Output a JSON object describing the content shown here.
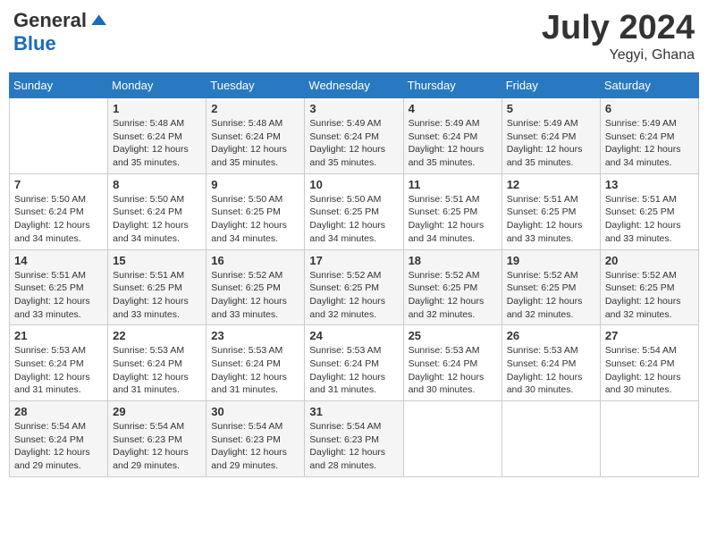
{
  "header": {
    "logo_general": "General",
    "logo_blue": "Blue",
    "month_year": "July 2024",
    "location": "Yegyi, Ghana"
  },
  "weekdays": [
    "Sunday",
    "Monday",
    "Tuesday",
    "Wednesday",
    "Thursday",
    "Friday",
    "Saturday"
  ],
  "weeks": [
    [
      {
        "day": "",
        "sunrise": "",
        "sunset": "",
        "daylight": ""
      },
      {
        "day": "1",
        "sunrise": "Sunrise: 5:48 AM",
        "sunset": "Sunset: 6:24 PM",
        "daylight": "Daylight: 12 hours and 35 minutes."
      },
      {
        "day": "2",
        "sunrise": "Sunrise: 5:48 AM",
        "sunset": "Sunset: 6:24 PM",
        "daylight": "Daylight: 12 hours and 35 minutes."
      },
      {
        "day": "3",
        "sunrise": "Sunrise: 5:49 AM",
        "sunset": "Sunset: 6:24 PM",
        "daylight": "Daylight: 12 hours and 35 minutes."
      },
      {
        "day": "4",
        "sunrise": "Sunrise: 5:49 AM",
        "sunset": "Sunset: 6:24 PM",
        "daylight": "Daylight: 12 hours and 35 minutes."
      },
      {
        "day": "5",
        "sunrise": "Sunrise: 5:49 AM",
        "sunset": "Sunset: 6:24 PM",
        "daylight": "Daylight: 12 hours and 35 minutes."
      },
      {
        "day": "6",
        "sunrise": "Sunrise: 5:49 AM",
        "sunset": "Sunset: 6:24 PM",
        "daylight": "Daylight: 12 hours and 34 minutes."
      }
    ],
    [
      {
        "day": "7",
        "sunrise": "Sunrise: 5:50 AM",
        "sunset": "Sunset: 6:24 PM",
        "daylight": "Daylight: 12 hours and 34 minutes."
      },
      {
        "day": "8",
        "sunrise": "Sunrise: 5:50 AM",
        "sunset": "Sunset: 6:24 PM",
        "daylight": "Daylight: 12 hours and 34 minutes."
      },
      {
        "day": "9",
        "sunrise": "Sunrise: 5:50 AM",
        "sunset": "Sunset: 6:25 PM",
        "daylight": "Daylight: 12 hours and 34 minutes."
      },
      {
        "day": "10",
        "sunrise": "Sunrise: 5:50 AM",
        "sunset": "Sunset: 6:25 PM",
        "daylight": "Daylight: 12 hours and 34 minutes."
      },
      {
        "day": "11",
        "sunrise": "Sunrise: 5:51 AM",
        "sunset": "Sunset: 6:25 PM",
        "daylight": "Daylight: 12 hours and 34 minutes."
      },
      {
        "day": "12",
        "sunrise": "Sunrise: 5:51 AM",
        "sunset": "Sunset: 6:25 PM",
        "daylight": "Daylight: 12 hours and 33 minutes."
      },
      {
        "day": "13",
        "sunrise": "Sunrise: 5:51 AM",
        "sunset": "Sunset: 6:25 PM",
        "daylight": "Daylight: 12 hours and 33 minutes."
      }
    ],
    [
      {
        "day": "14",
        "sunrise": "Sunrise: 5:51 AM",
        "sunset": "Sunset: 6:25 PM",
        "daylight": "Daylight: 12 hours and 33 minutes."
      },
      {
        "day": "15",
        "sunrise": "Sunrise: 5:51 AM",
        "sunset": "Sunset: 6:25 PM",
        "daylight": "Daylight: 12 hours and 33 minutes."
      },
      {
        "day": "16",
        "sunrise": "Sunrise: 5:52 AM",
        "sunset": "Sunset: 6:25 PM",
        "daylight": "Daylight: 12 hours and 33 minutes."
      },
      {
        "day": "17",
        "sunrise": "Sunrise: 5:52 AM",
        "sunset": "Sunset: 6:25 PM",
        "daylight": "Daylight: 12 hours and 32 minutes."
      },
      {
        "day": "18",
        "sunrise": "Sunrise: 5:52 AM",
        "sunset": "Sunset: 6:25 PM",
        "daylight": "Daylight: 12 hours and 32 minutes."
      },
      {
        "day": "19",
        "sunrise": "Sunrise: 5:52 AM",
        "sunset": "Sunset: 6:25 PM",
        "daylight": "Daylight: 12 hours and 32 minutes."
      },
      {
        "day": "20",
        "sunrise": "Sunrise: 5:52 AM",
        "sunset": "Sunset: 6:25 PM",
        "daylight": "Daylight: 12 hours and 32 minutes."
      }
    ],
    [
      {
        "day": "21",
        "sunrise": "Sunrise: 5:53 AM",
        "sunset": "Sunset: 6:24 PM",
        "daylight": "Daylight: 12 hours and 31 minutes."
      },
      {
        "day": "22",
        "sunrise": "Sunrise: 5:53 AM",
        "sunset": "Sunset: 6:24 PM",
        "daylight": "Daylight: 12 hours and 31 minutes."
      },
      {
        "day": "23",
        "sunrise": "Sunrise: 5:53 AM",
        "sunset": "Sunset: 6:24 PM",
        "daylight": "Daylight: 12 hours and 31 minutes."
      },
      {
        "day": "24",
        "sunrise": "Sunrise: 5:53 AM",
        "sunset": "Sunset: 6:24 PM",
        "daylight": "Daylight: 12 hours and 31 minutes."
      },
      {
        "day": "25",
        "sunrise": "Sunrise: 5:53 AM",
        "sunset": "Sunset: 6:24 PM",
        "daylight": "Daylight: 12 hours and 30 minutes."
      },
      {
        "day": "26",
        "sunrise": "Sunrise: 5:53 AM",
        "sunset": "Sunset: 6:24 PM",
        "daylight": "Daylight: 12 hours and 30 minutes."
      },
      {
        "day": "27",
        "sunrise": "Sunrise: 5:54 AM",
        "sunset": "Sunset: 6:24 PM",
        "daylight": "Daylight: 12 hours and 30 minutes."
      }
    ],
    [
      {
        "day": "28",
        "sunrise": "Sunrise: 5:54 AM",
        "sunset": "Sunset: 6:24 PM",
        "daylight": "Daylight: 12 hours and 29 minutes."
      },
      {
        "day": "29",
        "sunrise": "Sunrise: 5:54 AM",
        "sunset": "Sunset: 6:23 PM",
        "daylight": "Daylight: 12 hours and 29 minutes."
      },
      {
        "day": "30",
        "sunrise": "Sunrise: 5:54 AM",
        "sunset": "Sunset: 6:23 PM",
        "daylight": "Daylight: 12 hours and 29 minutes."
      },
      {
        "day": "31",
        "sunrise": "Sunrise: 5:54 AM",
        "sunset": "Sunset: 6:23 PM",
        "daylight": "Daylight: 12 hours and 28 minutes."
      },
      {
        "day": "",
        "sunrise": "",
        "sunset": "",
        "daylight": ""
      },
      {
        "day": "",
        "sunrise": "",
        "sunset": "",
        "daylight": ""
      },
      {
        "day": "",
        "sunrise": "",
        "sunset": "",
        "daylight": ""
      }
    ]
  ]
}
